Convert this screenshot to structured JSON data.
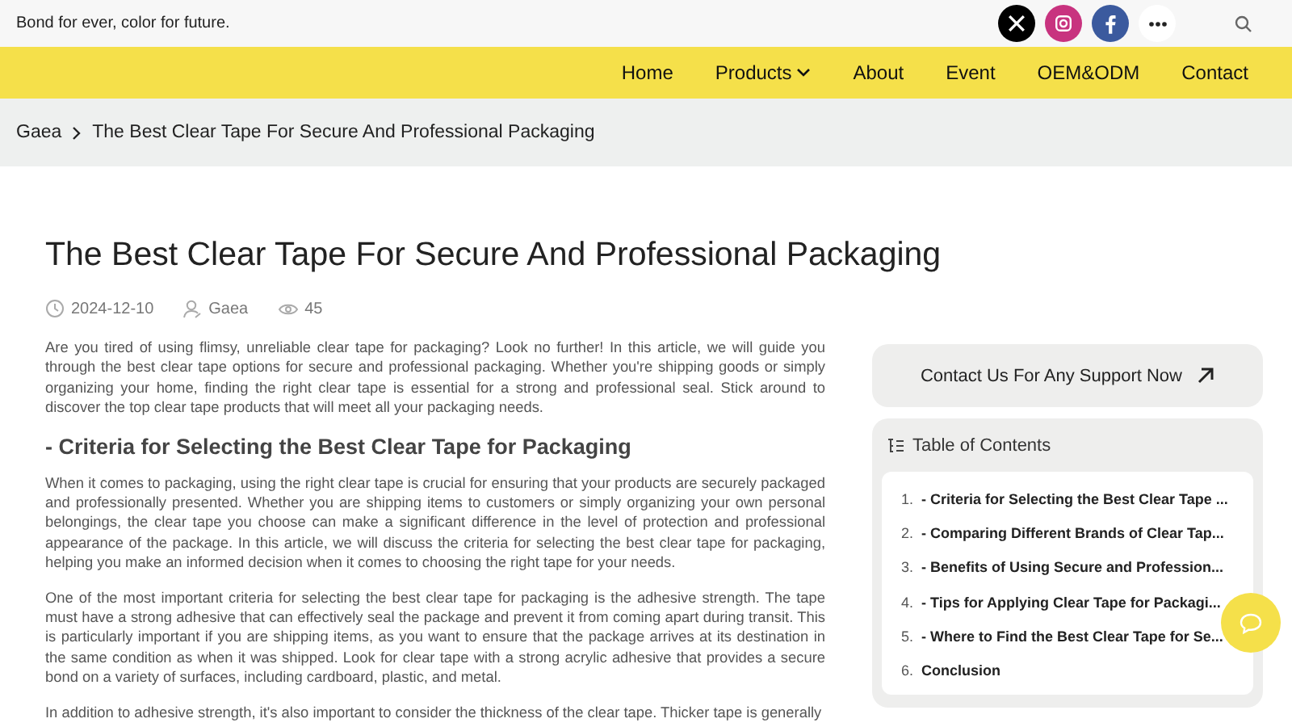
{
  "topbar": {
    "tagline": "Bond for ever, color for future.",
    "social": [
      {
        "kind": "x"
      },
      {
        "kind": "instagram"
      },
      {
        "kind": "facebook"
      },
      {
        "kind": "more"
      }
    ]
  },
  "nav": [
    {
      "label": "Home",
      "dropdown": false
    },
    {
      "label": "Products",
      "dropdown": true
    },
    {
      "label": "About",
      "dropdown": false
    },
    {
      "label": "Event",
      "dropdown": false
    },
    {
      "label": "OEM&ODM",
      "dropdown": false
    },
    {
      "label": "Contact",
      "dropdown": false
    }
  ],
  "breadcrumb": [
    "Gaea",
    "The Best Clear Tape For Secure And Professional Packaging"
  ],
  "article": {
    "title": "The Best Clear Tape For Secure And Professional Packaging",
    "date": "2024-12-10",
    "author": "Gaea",
    "views": "45",
    "blocks": [
      {
        "kind": "p",
        "text": "Are you tired of using flimsy, unreliable clear tape for packaging? Look no further! In this article, we will guide you through the best clear tape options for secure and professional packaging. Whether you're shipping goods or simply organizing your home, finding the right clear tape is essential for a strong and professional seal. Stick around to discover the top clear tape products that will meet all your packaging needs."
      },
      {
        "kind": "h",
        "text": "- Criteria for Selecting the Best Clear Tape for Packaging"
      },
      {
        "kind": "p",
        "text": "When it comes to packaging, using the right clear tape is crucial for ensuring that your products are securely packaged and professionally presented. Whether you are shipping items to customers or simply organizing your own personal belongings, the clear tape you choose can make a significant difference in the level of protection and professional appearance of the package. In this article, we will discuss the criteria for selecting the best clear tape for packaging, helping you make an informed decision when it comes to choosing the right tape for your needs."
      },
      {
        "kind": "p",
        "text": "One of the most important criteria for selecting the best clear tape for packaging is the adhesive strength. The tape must have a strong adhesive that can effectively seal the package and prevent it from coming apart during transit. This is particularly important if you are shipping items, as you want to ensure that the package arrives at its destination in the same condition as when it was shipped. Look for clear tape with a strong acrylic adhesive that provides a secure bond on a variety of surfaces, including cardboard, plastic, and metal."
      },
      {
        "kind": "p",
        "text": "In addition to adhesive strength, it's also important to consider the thickness of the clear tape. Thicker tape is generally"
      }
    ]
  },
  "sidebar": {
    "contact_button": "Contact Us For Any Support Now",
    "toc_title": "Table of Contents",
    "toc": [
      {
        "number": "1.",
        "label": "- Criteria for Selecting the Best Clear Tape ..."
      },
      {
        "number": "2.",
        "label": "- Comparing Different Brands of Clear Tap..."
      },
      {
        "number": "3.",
        "label": "- Benefits of Using Secure and Profession..."
      },
      {
        "number": "4.",
        "label": "- Tips for Applying Clear Tape for Packagi..."
      },
      {
        "number": "5.",
        "label": "- Where to Find the Best Clear Tape for Se..."
      },
      {
        "number": "6.",
        "label": "Conclusion"
      }
    ]
  }
}
